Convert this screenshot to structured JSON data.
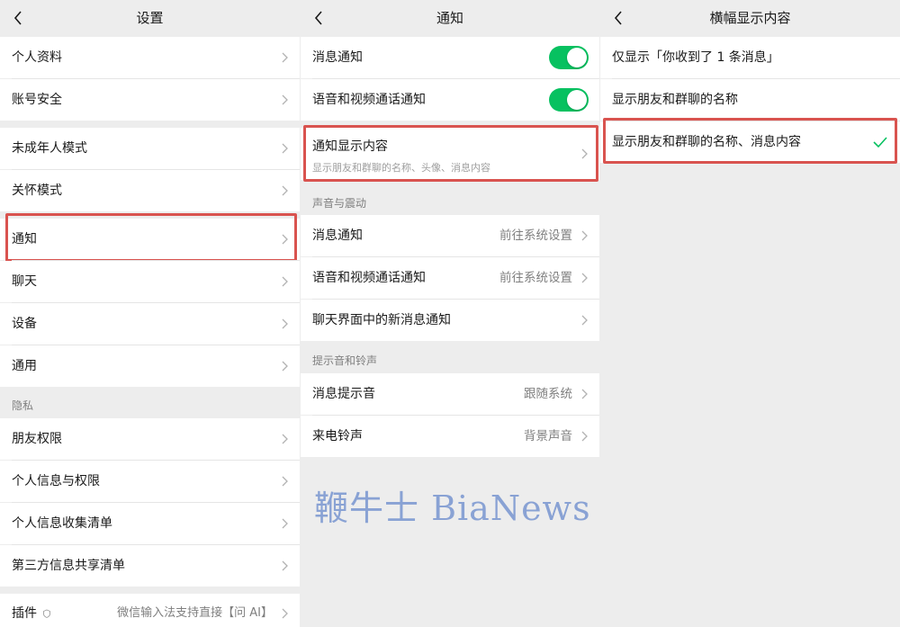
{
  "panel1": {
    "title": "设置",
    "items": [
      {
        "label": "个人资料"
      },
      {
        "label": "账号安全"
      },
      {
        "label": "未成年人模式"
      },
      {
        "label": "关怀模式"
      },
      {
        "label": "通知"
      },
      {
        "label": "聊天"
      },
      {
        "label": "设备"
      },
      {
        "label": "通用"
      },
      {
        "label": "朋友权限"
      },
      {
        "label": "个人信息与权限"
      },
      {
        "label": "个人信息收集清单"
      },
      {
        "label": "第三方信息共享清单"
      },
      {
        "label": "插件",
        "value": "微信输入法支持直接【问 AI】"
      }
    ],
    "section_privacy": "隐私"
  },
  "panel2": {
    "title": "通知",
    "msg_notify": "消息通知",
    "voice_video_notify": "语音和视频通话通知",
    "display_content": "通知显示内容",
    "display_content_sub": "显示朋友和群聊的名称、头像、消息内容",
    "section_sound": "声音与震动",
    "sound_msg": "消息通知",
    "sound_msg_value": "前往系统设置",
    "sound_call": "语音和视频通话通知",
    "sound_call_value": "前往系统设置",
    "chat_new_msg": "聊天界面中的新消息通知",
    "section_ring": "提示音和铃声",
    "ring_msg": "消息提示音",
    "ring_msg_value": "跟随系统",
    "ring_call": "来电铃声",
    "ring_call_value": "背景声音",
    "toggle_on": true
  },
  "panel3": {
    "title": "横幅显示内容",
    "options": [
      {
        "label": "仅显示「你收到了 1 条消息」"
      },
      {
        "label": "显示朋友和群聊的名称"
      },
      {
        "label": "显示朋友和群聊的名称、消息内容",
        "selected": true
      }
    ]
  },
  "watermark": "鞭牛士 BiaNews",
  "colors": {
    "accent_green": "#07c160",
    "highlight_red": "#d9534f",
    "bg": "#ededed"
  }
}
